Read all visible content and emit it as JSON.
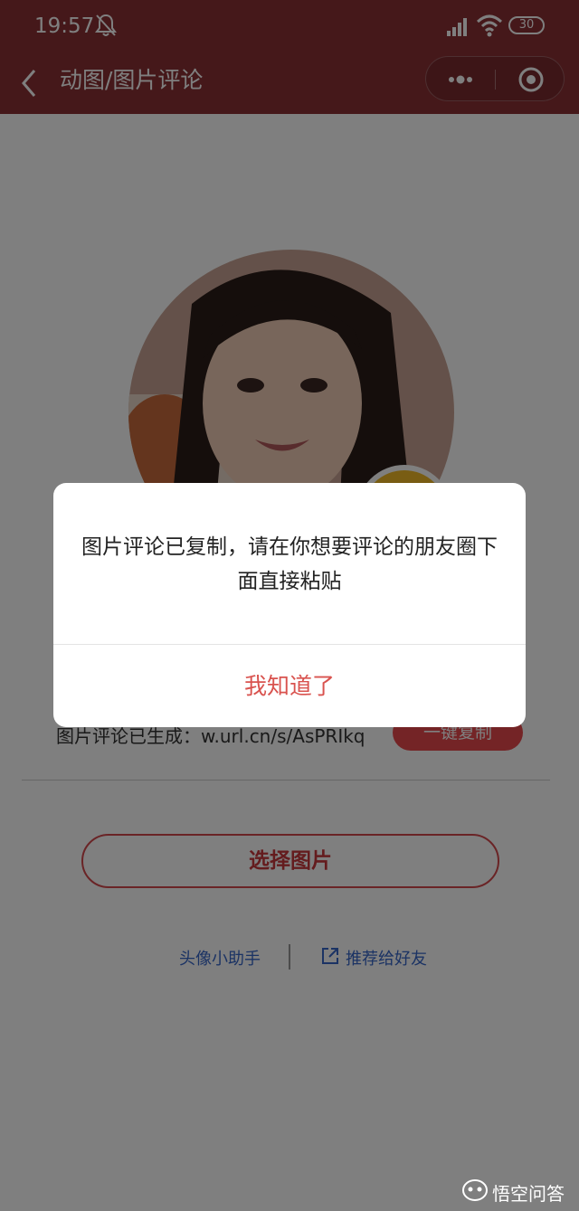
{
  "status_bar": {
    "time": "19:57",
    "battery": "30"
  },
  "nav": {
    "title": "动图/图片评论"
  },
  "content": {
    "url_text": "图片评论已生成：w.url.cn/s/AsPRIkq",
    "copy_button": "一键复制",
    "select_button": "选择图片",
    "link_helper": "头像小助手",
    "link_share": "推荐给好友"
  },
  "modal": {
    "message": "图片评论已复制，请在你想要评论的朋友圈下面直接粘贴",
    "confirm_button": "我知道了"
  },
  "watermark": {
    "text": "悟空问答"
  },
  "colors": {
    "nav_bg": "#8b3034",
    "accent": "#d9534f",
    "link": "#3766c9"
  },
  "icons": [
    "back-chevron-icon",
    "more-dots-icon",
    "close-circle-icon",
    "mute-bell-icon",
    "signal-icon",
    "wifi-icon",
    "share-link-icon",
    "wukong-logo-icon"
  ]
}
